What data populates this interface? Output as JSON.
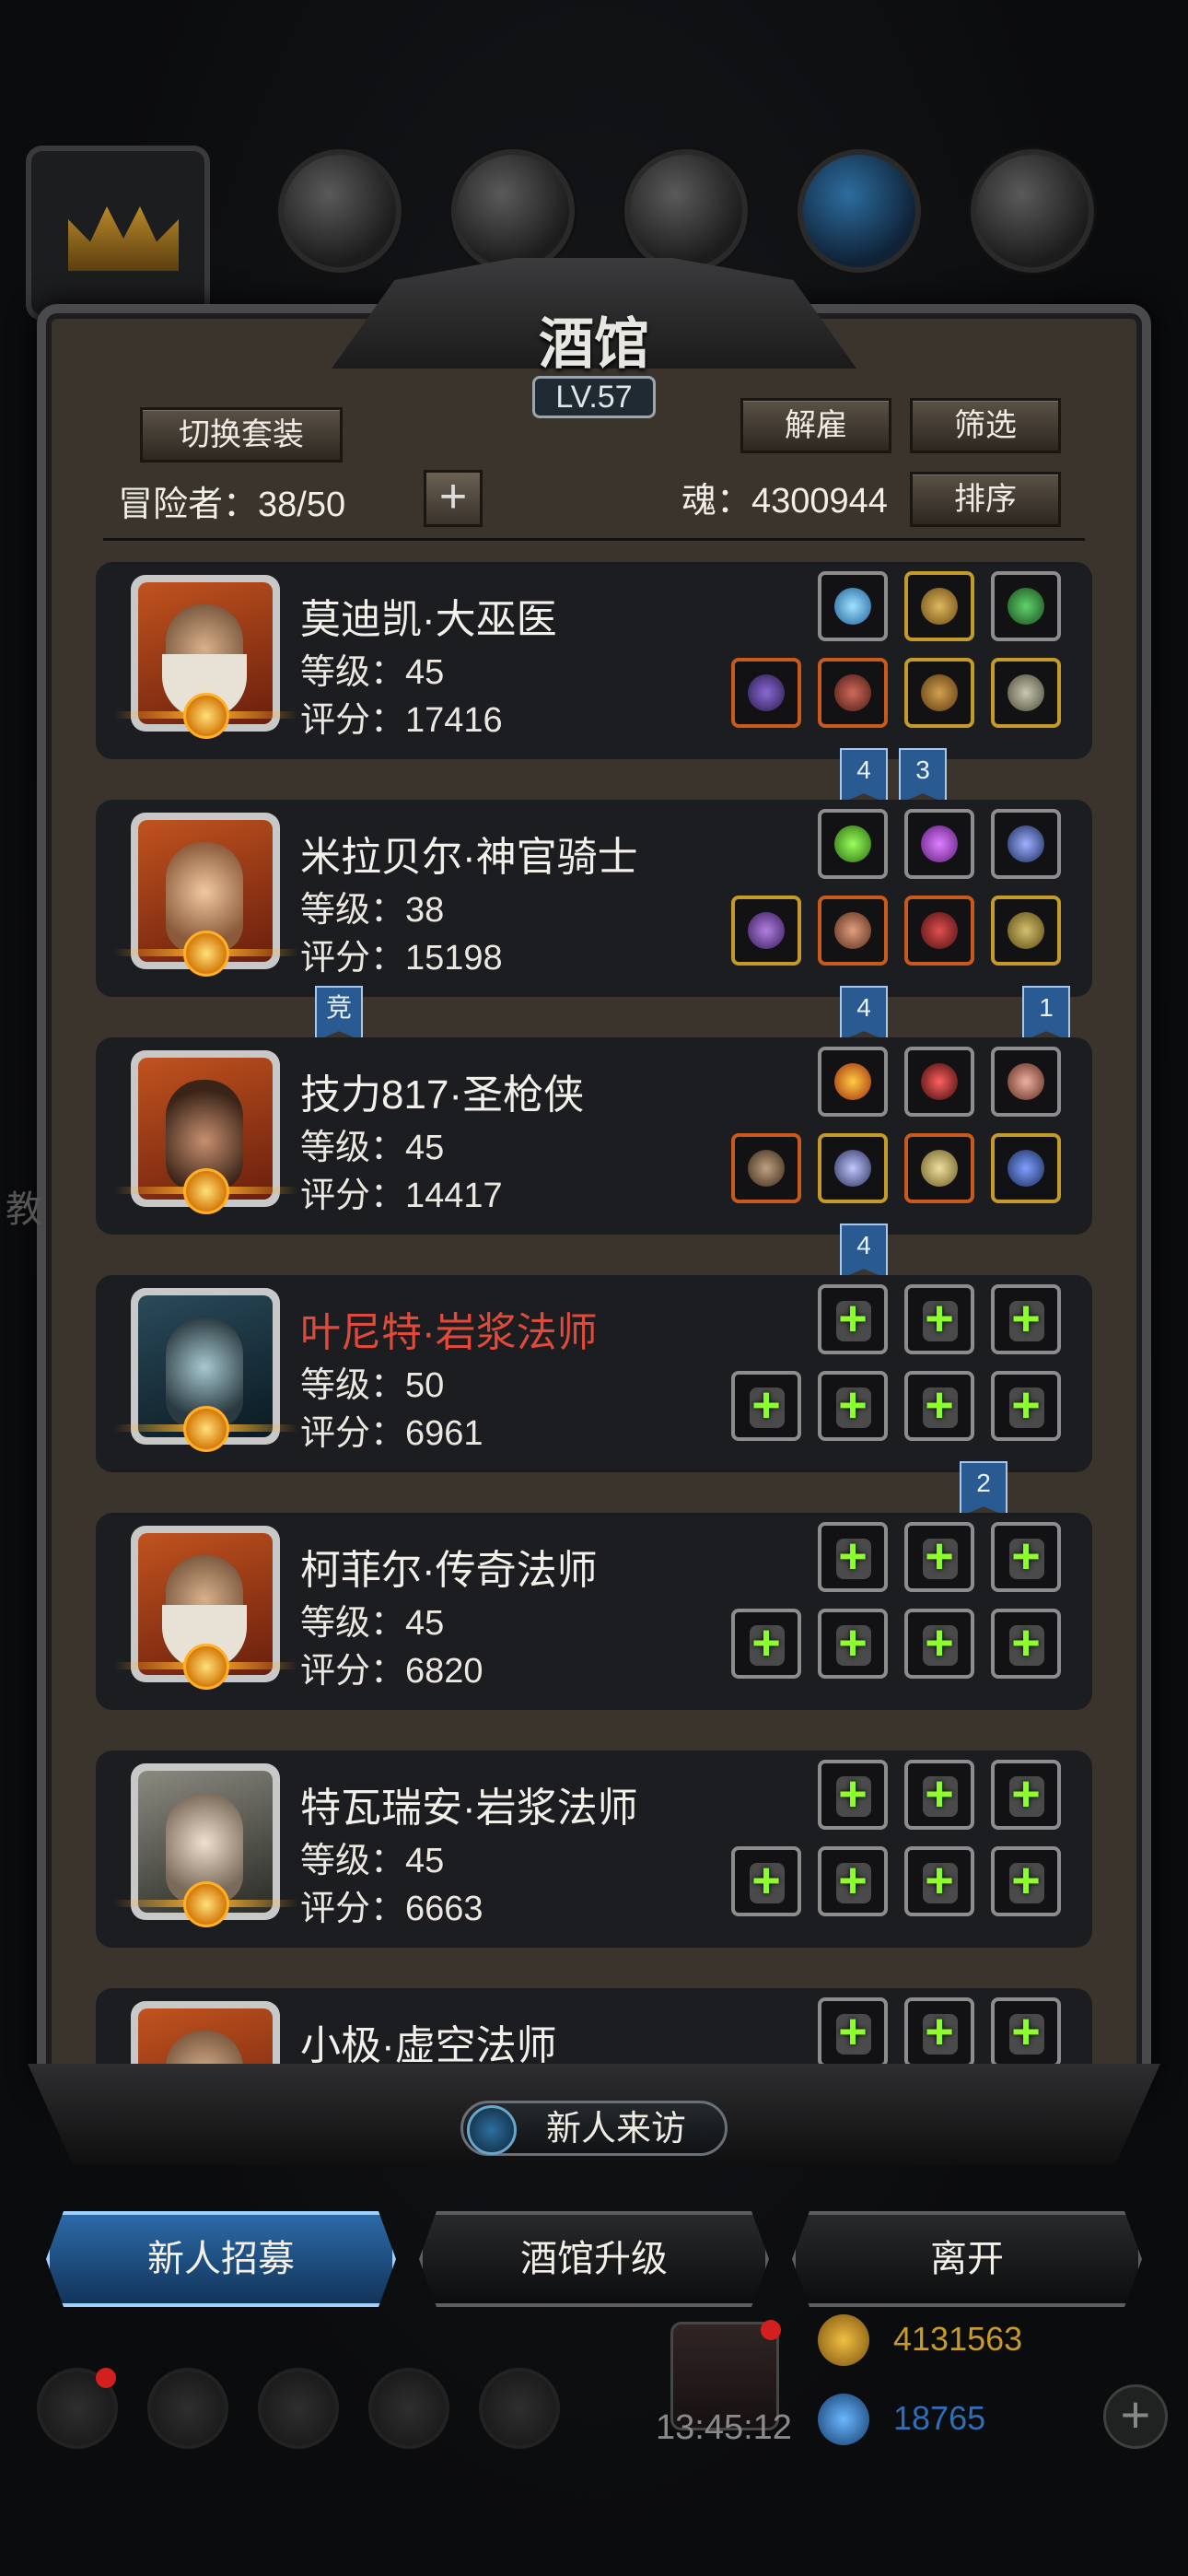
{
  "header": {
    "title": "酒馆",
    "level_badge": "LV.57",
    "switch_outfit": "切换套装",
    "dismiss": "解雇",
    "filter": "筛选",
    "sort": "排序",
    "adventurers_label": "冒险者：38/50",
    "add_label": "+",
    "soul_label": "魂：4300944"
  },
  "heroes": [
    {
      "name": "莫迪凯·大巫医",
      "level": "等级：45",
      "score": "评分：17416",
      "highlight": false
    },
    {
      "name": "米拉贝尔·神官骑士",
      "level": "等级：38",
      "score": "评分：15198",
      "highlight": false
    },
    {
      "name": "技力817·圣枪侠",
      "level": "等级：45",
      "score": "评分：14417",
      "highlight": false
    },
    {
      "name": "叶尼特·岩浆法师",
      "level": "等级：50",
      "score": "评分：6961",
      "highlight": true
    },
    {
      "name": "柯菲尔·传奇法师",
      "level": "等级：45",
      "score": "评分：6820",
      "highlight": false
    },
    {
      "name": "特瓦瑞安·岩浆法师",
      "level": "等级：45",
      "score": "评分：6663",
      "highlight": false
    },
    {
      "name": "小极·虚空法师",
      "level": "",
      "score": "",
      "highlight": false
    }
  ],
  "tags": {
    "t1": "4",
    "t2": "3",
    "t3": "竞",
    "t4": "4",
    "t5": "1",
    "t6": "4",
    "t7": "2"
  },
  "bottom": {
    "visitor": "新人来访",
    "recruit": "新人招募",
    "upgrade": "酒馆升级",
    "leave": "离开",
    "timer": "13:45:12",
    "gold": "4131563",
    "gems": "18765",
    "side_hint": "教"
  },
  "colors": {
    "plus_green": "#8cff2a",
    "highlight_red": "#e04a3a",
    "gold_text": "#c89a2a",
    "gem_text": "#2f6fb8"
  }
}
